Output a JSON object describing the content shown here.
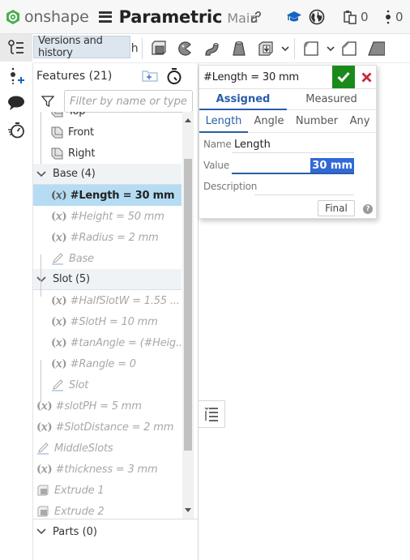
{
  "app": {
    "brand": "onshape",
    "document_title": "Parametric",
    "branch": "Main",
    "parts_count": "0",
    "people_count": "0"
  },
  "tooltip": "Versions and history",
  "toolbar": {
    "sketch_label": "etch"
  },
  "features_panel": {
    "title": "Features (21)",
    "filter_placeholder": "Filter by name or type",
    "rows": [
      {
        "kind": "plane",
        "label": "Top",
        "indent": 1,
        "dim": false
      },
      {
        "kind": "plane",
        "label": "Front",
        "indent": 1,
        "dim": false
      },
      {
        "kind": "plane",
        "label": "Right",
        "indent": 1,
        "dim": false
      },
      {
        "kind": "folder",
        "label": "Base (4)"
      },
      {
        "kind": "variable",
        "label": "#Length = 30 mm",
        "indent": 1,
        "selected": true
      },
      {
        "kind": "variable",
        "label": "#Height = 50 mm",
        "indent": 1,
        "dim": true
      },
      {
        "kind": "variable",
        "label": "#Radius = 2 mm",
        "indent": 1,
        "dim": true
      },
      {
        "kind": "sketch",
        "label": "Base",
        "indent": 1,
        "dim": true
      },
      {
        "kind": "folder",
        "label": "Slot (5)"
      },
      {
        "kind": "variable",
        "label": "#HalfSlotW = 1.55 ...",
        "indent": 1,
        "dim": true
      },
      {
        "kind": "variable",
        "label": "#SlotH = 10 mm",
        "indent": 1,
        "dim": true
      },
      {
        "kind": "variable",
        "label": "#tanAngle = (#Heig...",
        "indent": 1,
        "dim": true
      },
      {
        "kind": "variable",
        "label": "#Rangle = 0",
        "indent": 1,
        "dim": true
      },
      {
        "kind": "sketch",
        "label": "Slot",
        "indent": 1,
        "dim": true
      },
      {
        "kind": "variable",
        "label": "#slotPH = 5 mm",
        "indent": 0,
        "dim": true
      },
      {
        "kind": "variable",
        "label": "#SlotDistance = 2 mm",
        "indent": 0,
        "dim": true
      },
      {
        "kind": "sketch",
        "label": "MiddleSlots",
        "indent": 0,
        "dim": true
      },
      {
        "kind": "variable",
        "label": "#thickness = 3 mm",
        "indent": 0,
        "dim": true
      },
      {
        "kind": "extrude",
        "label": "Extrude 1",
        "indent": 0,
        "dim": true
      },
      {
        "kind": "extrude",
        "label": "Extrude 2",
        "indent": 0,
        "dim": true
      }
    ],
    "parts_label": "Parts (0)"
  },
  "variable_dialog": {
    "title": "#Length = 30 mm",
    "tabs": [
      "Assigned",
      "Measured"
    ],
    "active_tab": "Assigned",
    "subtabs": [
      "Length",
      "Angle",
      "Number",
      "Any"
    ],
    "active_subtab": "Length",
    "name_label": "Name",
    "name_value": "Length",
    "value_label": "Value",
    "value_value": "30 mm",
    "description_label": "Description",
    "description_value": "",
    "final_label": "Final",
    "help_label": "?"
  },
  "colors": {
    "brand_green": "#43a047",
    "accept_green": "#1b8a1b",
    "cancel_red": "#c8283a",
    "accent_blue": "#2a5da8",
    "selection_blue": "#b5dcf2"
  }
}
